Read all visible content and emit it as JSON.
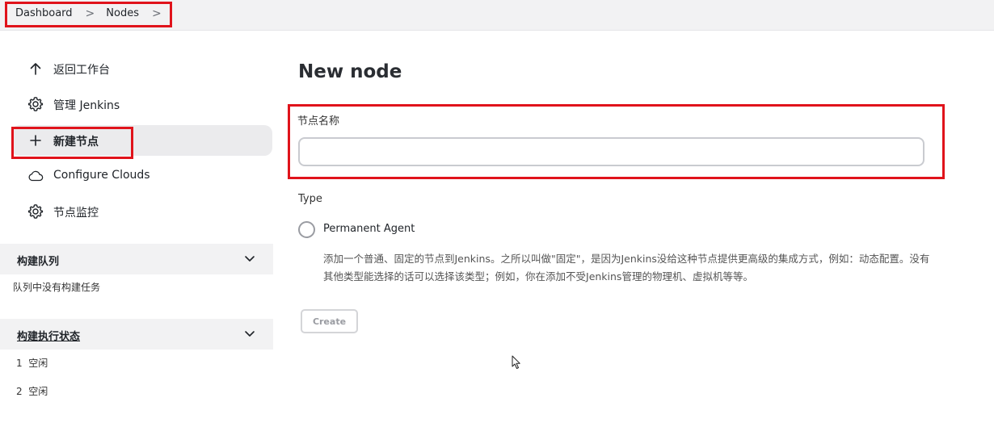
{
  "breadcrumb": {
    "items": [
      "Dashboard",
      "Nodes"
    ],
    "separator": ">"
  },
  "sidebar": {
    "tasks": [
      {
        "label": "返回工作台",
        "icon": "arrow-up-icon"
      },
      {
        "label": "管理 Jenkins",
        "icon": "gear-icon"
      },
      {
        "label": "新建节点",
        "icon": "plus-icon",
        "active": true
      },
      {
        "label": "Configure Clouds",
        "icon": "cloud-icon"
      },
      {
        "label": "节点监控",
        "icon": "gear-icon"
      }
    ],
    "build_queue": {
      "title": "构建队列",
      "empty_text": "队列中没有构建任务"
    },
    "executors": {
      "title": "构建执行状态",
      "items": [
        {
          "number": "1",
          "status": "空闲"
        },
        {
          "number": "2",
          "status": "空闲"
        }
      ]
    }
  },
  "main": {
    "title": "New node",
    "node_name": {
      "label": "节点名称",
      "value": ""
    },
    "type": {
      "label": "Type",
      "options": [
        {
          "label": "Permanent Agent",
          "selected": false,
          "description": "添加一个普通、固定的节点到Jenkins。之所以叫做\"固定\"，是因为Jenkins没给这种节点提供更高级的集成方式，例如：动态配置。没有其他类型能选择的话可以选择该类型；例如，你在添加不受Jenkins管理的物理机、虚拟机等等。"
        }
      ]
    },
    "create_button": "Create"
  },
  "colors": {
    "highlight": "#e0131b",
    "active_bg": "#ebebed",
    "panel_bg": "#f2f2f3"
  }
}
